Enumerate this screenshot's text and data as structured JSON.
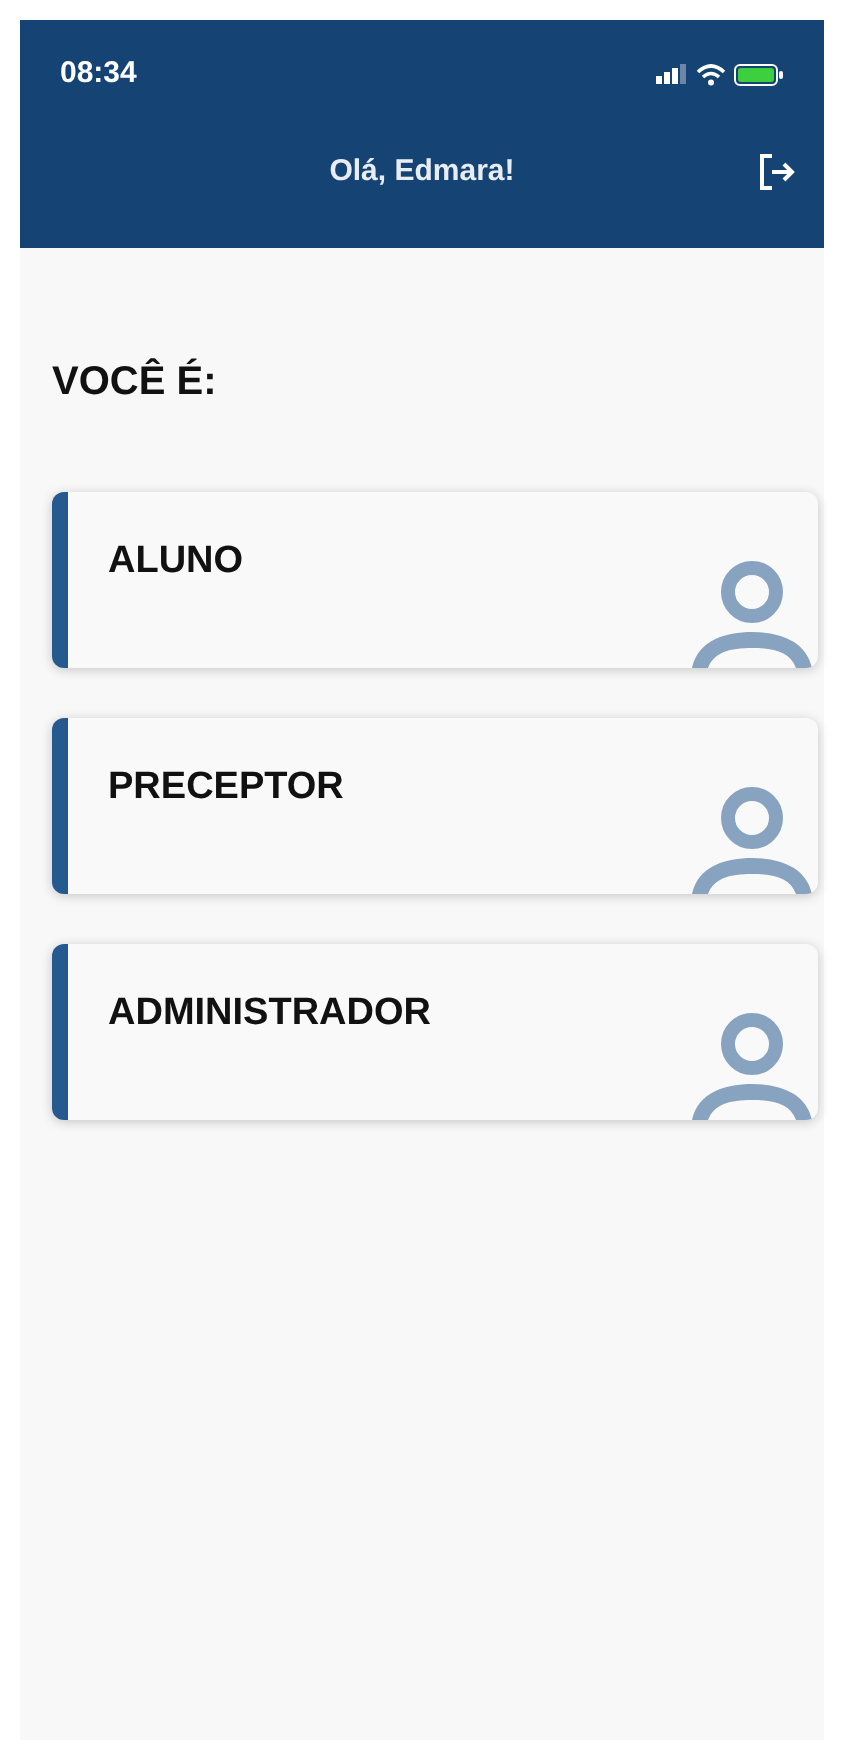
{
  "status_bar": {
    "time": "08:34"
  },
  "header": {
    "title": "Olá, Edmara!"
  },
  "heading": "VOCÊ É:",
  "roles": [
    {
      "label": "ALUNO"
    },
    {
      "label": "PRECEPTOR"
    },
    {
      "label": "ADMINISTRADOR"
    }
  ]
}
